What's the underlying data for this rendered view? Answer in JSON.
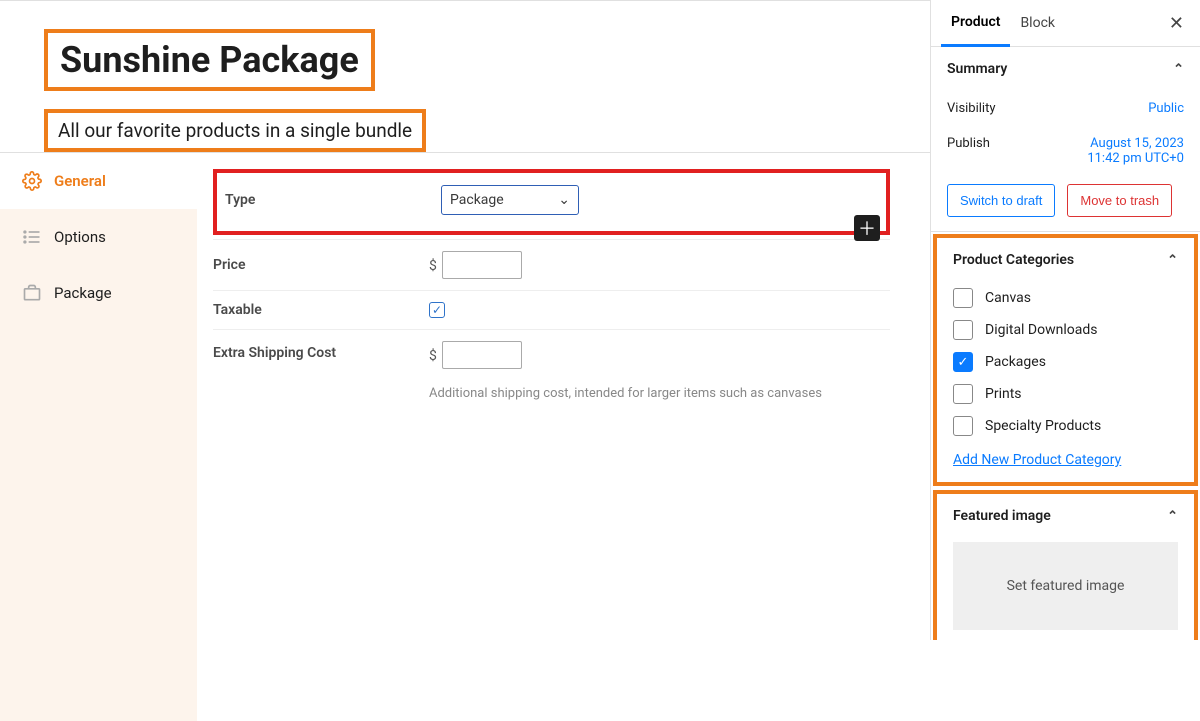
{
  "header": {
    "title": "Sunshine Package",
    "subtitle": "All our favorite products in a single bundle"
  },
  "leftNav": {
    "items": [
      {
        "label": "General"
      },
      {
        "label": "Options"
      },
      {
        "label": "Package"
      }
    ]
  },
  "form": {
    "type_label": "Type",
    "type_value": "Package",
    "price_label": "Price",
    "price_currency": "$",
    "price_value": "",
    "taxable_label": "Taxable",
    "taxable_checked": true,
    "ship_label": "Extra Shipping Cost",
    "ship_currency": "$",
    "ship_value": "",
    "ship_help": "Additional shipping cost, intended for larger items such as canvases"
  },
  "sidebar": {
    "tabs": {
      "product": "Product",
      "block": "Block"
    },
    "summary": {
      "title": "Summary",
      "visibility_label": "Visibility",
      "visibility_value": "Public",
      "publish_label": "Publish",
      "publish_value_line1": "August 15, 2023",
      "publish_value_line2": "11:42 pm UTC+0",
      "switch_draft": "Switch to draft",
      "move_trash": "Move to trash"
    },
    "categories": {
      "title": "Product Categories",
      "items": [
        {
          "label": "Canvas",
          "checked": false
        },
        {
          "label": "Digital Downloads",
          "checked": false
        },
        {
          "label": "Packages",
          "checked": true
        },
        {
          "label": "Prints",
          "checked": false
        },
        {
          "label": "Specialty Products",
          "checked": false
        }
      ],
      "add_new": "Add New Product Category"
    },
    "featured": {
      "title": "Featured image",
      "placeholder": "Set featured image"
    }
  }
}
